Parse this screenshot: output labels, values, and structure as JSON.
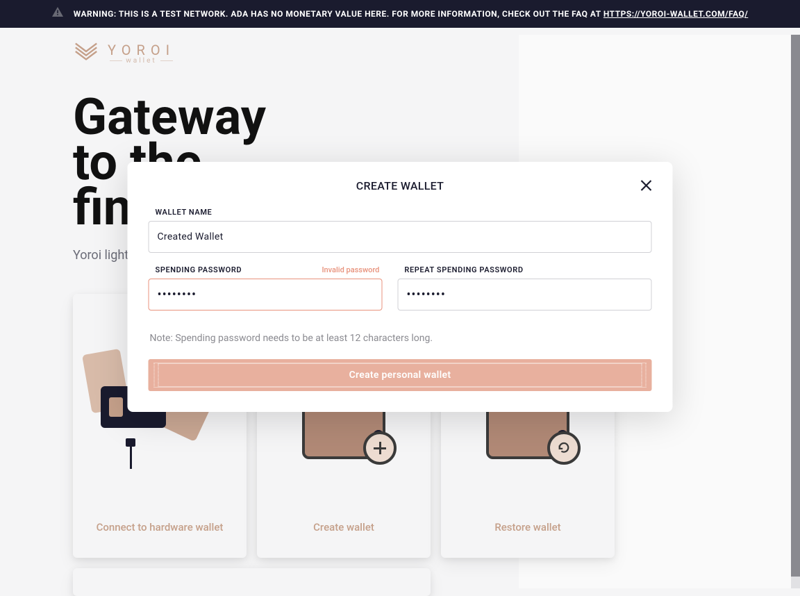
{
  "warning": {
    "prefix": "WARNING: THIS IS A TEST NETWORK. ADA HAS NO MONETARY VALUE HERE. FOR MORE INFORMATION, CHECK OUT THE FAQ AT ",
    "link_text": "HTTPS://YOROI-WALLET.COM/FAQ/"
  },
  "logo": {
    "brand": "YOROI",
    "sub": "wallet"
  },
  "hero": {
    "title_l1": "Gateway",
    "title_l2": "to the",
    "title_l3": "financial world",
    "subtitle": "Yoroi light wallet for Cardano assets"
  },
  "cards": {
    "hardware": "Connect to hardware wallet",
    "create": "Create wallet",
    "restore": "Restore wallet"
  },
  "modal": {
    "title": "CREATE WALLET",
    "wallet_name_label": "WALLET NAME",
    "wallet_name_value": "Created Wallet",
    "spending_password_label": "SPENDING PASSWORD",
    "spending_password_error": "Invalid password",
    "spending_password_value": "asdfasdf",
    "repeat_password_label": "REPEAT SPENDING PASSWORD",
    "repeat_password_value": "asdfasdf",
    "note": "Note: Spending password needs to be at least 12 characters long.",
    "submit": "Create personal wallet"
  },
  "colors": {
    "accent": "#c5a08a",
    "dark": "#1a1b2e",
    "error": "#e8927c"
  }
}
